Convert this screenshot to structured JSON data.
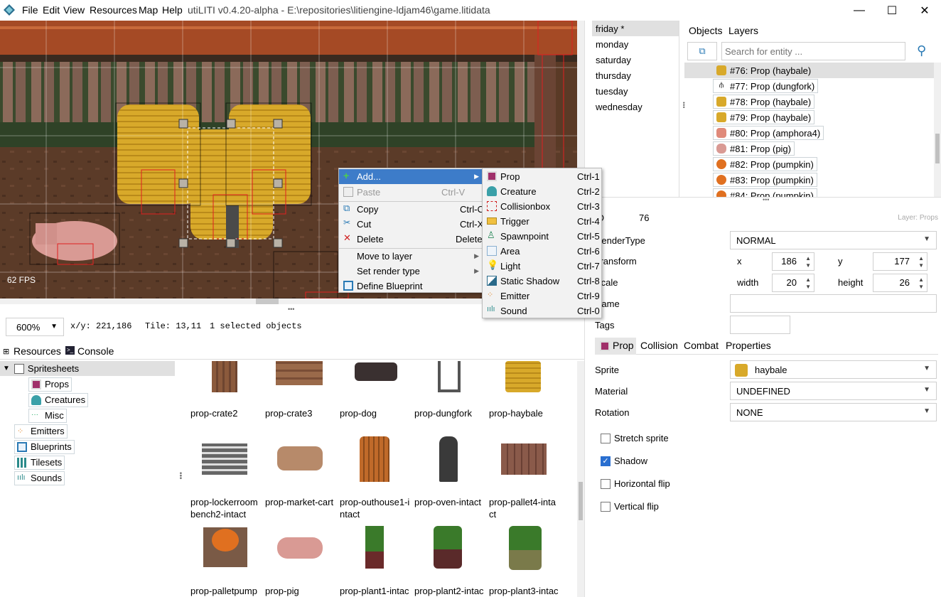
{
  "window": {
    "title": "utiLITI v0.4.20-alpha - E:\\repositories\\litiengine-ldjam46\\game.litidata",
    "menu": [
      "File",
      "Edit",
      "View",
      "Resources",
      "Map",
      "Help"
    ],
    "minimize": "—",
    "maximize": "☐",
    "close": "✕"
  },
  "canvas": {
    "fps": "62 FPS"
  },
  "status": {
    "zoom": "600%",
    "xy": "x/y: 221,186",
    "tile": "Tile: 13,11",
    "selection": "1 selected objects"
  },
  "bottom_tabs": {
    "resources": "Resources",
    "console": "Console"
  },
  "resource_tree": {
    "spritesheets": "Spritesheets",
    "props": "Props",
    "creatures": "Creatures",
    "misc": "Misc",
    "emitters": "Emitters",
    "blueprints": "Blueprints",
    "tilesets": "Tilesets",
    "sounds": "Sounds"
  },
  "sprites": [
    {
      "l1": "prop-crate2",
      "l2": ""
    },
    {
      "l1": "prop-crate3",
      "l2": ""
    },
    {
      "l1": "prop-dog",
      "l2": ""
    },
    {
      "l1": "prop-dungfork",
      "l2": ""
    },
    {
      "l1": "prop-haybale",
      "l2": ""
    },
    {
      "l1": "prop-lockerroom",
      "l2": "bench2-intact"
    },
    {
      "l1": "prop-market-cart",
      "l2": ""
    },
    {
      "l1": "prop-outhouse1-i",
      "l2": "ntact"
    },
    {
      "l1": "prop-oven-intact",
      "l2": ""
    },
    {
      "l1": "prop-pallet4-inta",
      "l2": "ct"
    },
    {
      "l1": "prop-palletpump",
      "l2": ""
    },
    {
      "l1": "prop-pig",
      "l2": ""
    },
    {
      "l1": "prop-plant1-intac",
      "l2": ""
    },
    {
      "l1": "prop-plant2-intac",
      "l2": ""
    },
    {
      "l1": "prop-plant3-intac",
      "l2": ""
    }
  ],
  "maps": [
    "friday *",
    "monday",
    "saturday",
    "thursday",
    "tuesday",
    "wednesday"
  ],
  "objects_tabs": {
    "objects": "Objects",
    "layers": "Layers"
  },
  "search": {
    "placeholder": "Search for entity ..."
  },
  "objects": [
    "#76: Prop (haybale)",
    "#77: Prop (dungfork)",
    "#78: Prop (haybale)",
    "#79: Prop (haybale)",
    "#80: Prop (amphora4)",
    "#81: Prop (pig)",
    "#82: Prop (pumpkin)",
    "#83: Prop (pumpkin)",
    "#84: Prop (pumpkin)"
  ],
  "props": {
    "id_label": "ID",
    "id_value": "76",
    "layer": "Layer: Props",
    "rendertype_label": "RenderType",
    "rendertype_value": "NORMAL",
    "transform_label": "Transform",
    "x_label": "x",
    "x_value": "186",
    "y_label": "y",
    "y_value": "177",
    "scale_label": "Scale",
    "width_label": "width",
    "width_value": "20",
    "height_label": "height",
    "height_value": "26",
    "name_label": "Name",
    "tags_label": "Tags"
  },
  "prop_tabs": {
    "prop": "Prop",
    "collision": "Collision",
    "combat": "Combat",
    "properties": "Properties"
  },
  "prop_fields": {
    "sprite_label": "Sprite",
    "sprite_value": "haybale",
    "material_label": "Material",
    "material_value": "UNDEFINED",
    "rotation_label": "Rotation",
    "rotation_value": "NONE",
    "stretch": "Stretch sprite",
    "shadow": "Shadow",
    "hflip": "Horizontal flip",
    "vflip": "Vertical flip"
  },
  "checkboxes": {
    "stretch": false,
    "shadow": true,
    "hflip": false,
    "vflip": false
  },
  "context_menu": {
    "add": "Add...",
    "paste": "Paste",
    "paste_sc": "Ctrl-V",
    "copy": "Copy",
    "copy_sc": "Ctrl-C",
    "cut": "Cut",
    "cut_sc": "Ctrl-X",
    "delete": "Delete",
    "delete_sc": "Delete",
    "move": "Move to layer",
    "render": "Set render type",
    "blueprint": "Define Blueprint"
  },
  "add_menu": [
    {
      "label": "Prop",
      "sc": "Ctrl-1",
      "icon": "prop-icon"
    },
    {
      "label": "Creature",
      "sc": "Ctrl-2",
      "icon": "creature-icon"
    },
    {
      "label": "Collisionbox",
      "sc": "Ctrl-3",
      "icon": "collisionbox-icon"
    },
    {
      "label": "Trigger",
      "sc": "Ctrl-4",
      "icon": "trigger-icon"
    },
    {
      "label": "Spawnpoint",
      "sc": "Ctrl-5",
      "icon": "spawnpoint-icon"
    },
    {
      "label": "Area",
      "sc": "Ctrl-6",
      "icon": "area-icon"
    },
    {
      "label": "Light",
      "sc": "Ctrl-7",
      "icon": "light-icon"
    },
    {
      "label": "Static Shadow",
      "sc": "Ctrl-8",
      "icon": "shadow-icon"
    },
    {
      "label": "Emitter",
      "sc": "Ctrl-9",
      "icon": "emitter-icon"
    },
    {
      "label": "Sound",
      "sc": "Ctrl-0",
      "icon": "sound-icon"
    }
  ],
  "colors": {
    "accent": "#3d7cc9",
    "selection": "#cce4f7",
    "tree_selected": "#e0e0e0"
  }
}
